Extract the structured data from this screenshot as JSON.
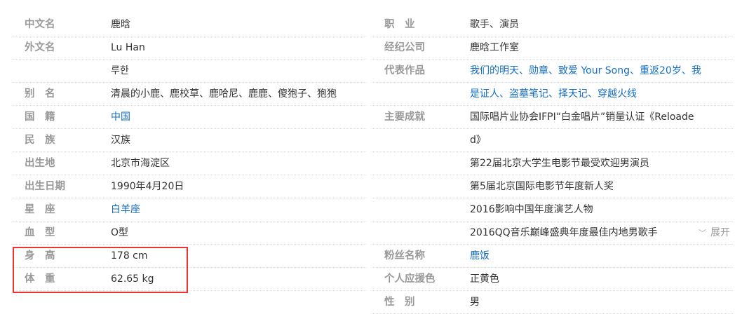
{
  "left": [
    {
      "label": "中文名",
      "value": "鹿晗"
    },
    {
      "label": "外文名",
      "value": "Lu Han"
    },
    {
      "label": "",
      "value": "루한"
    },
    {
      "label": "别　名",
      "value": "清晨的小鹿、鹿校草、鹿哈尼、鹿鹿、傻狍子、狍狍"
    },
    {
      "label": "国　籍",
      "value": "中国",
      "link": true
    },
    {
      "label": "民　族",
      "value": "汉族"
    },
    {
      "label": "出生地",
      "value": "北京市海淀区"
    },
    {
      "label": "出生日期",
      "value": "1990年4月20日"
    },
    {
      "label": "星　座",
      "value": "白羊座",
      "link": true
    },
    {
      "label": "血　型",
      "value": "O型"
    },
    {
      "label": "身　高",
      "value": "178 cm"
    },
    {
      "label": "体　重",
      "value": "62.65 kg"
    }
  ],
  "right": [
    {
      "label": "职　业",
      "value": "歌手、演员"
    },
    {
      "label": "经纪公司",
      "value": "鹿晗工作室"
    },
    {
      "label": "代表作品",
      "value": "我们的明天、勋章、致爱 Your Song、重返20岁、我",
      "link": true
    },
    {
      "label": "",
      "value": "是证人、盗墓笔记、择天记、穿越火线",
      "link": true
    },
    {
      "label": "主要成就",
      "value": "国际唱片业协会IFPI“白金唱片”销量认证《Reloade"
    },
    {
      "label": "",
      "value": "d》"
    },
    {
      "label": "",
      "value": "第22届北京大学生电影节最受欢迎男演员"
    },
    {
      "label": "",
      "value": "第5届北京国际电影节年度新人奖"
    },
    {
      "label": "",
      "value": "2016影响中国年度演艺人物"
    },
    {
      "label": "",
      "value": "2016QQ音乐巅峰盛典年度最佳内地男歌手"
    },
    {
      "label": "粉丝名称",
      "value": "鹿饭",
      "link": true
    },
    {
      "label": "个人应援色",
      "value": "正黄色"
    },
    {
      "label": "性　别",
      "value": "男"
    }
  ],
  "expand_label": "展开"
}
